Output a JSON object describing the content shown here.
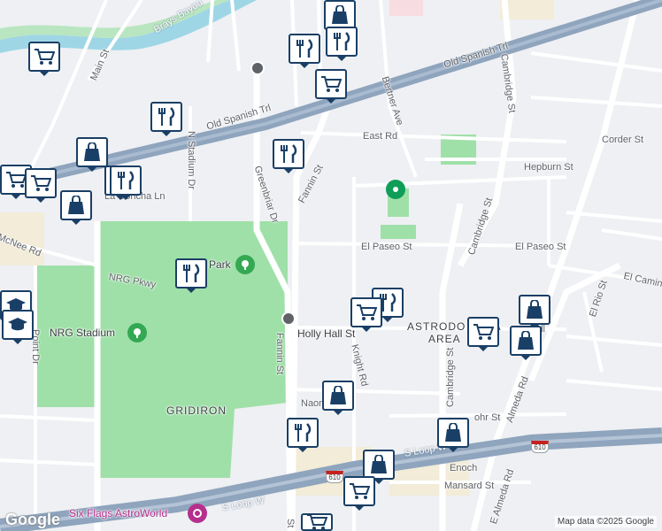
{
  "map": {
    "colors": {
      "background": "#eef0f3",
      "park": "#9fe0a8",
      "highway": "#8fa4bd",
      "water": "#9fd6e6",
      "pin_border": "#1a3f66"
    },
    "streets": {
      "brays_bayou": "Brays Bayou",
      "main_st": "Main St",
      "old_spanish_trl_top": "Old Spanish Trl",
      "old_spanish_trl_left": "Old Spanish Trl",
      "bertner_ave": "Bertner Ave",
      "cambridge_st_top": "Cambridge St",
      "cambridge_st_mid": "Cambridge St",
      "cambridge_st_low": "Cambridge St",
      "east_rd": "East Rd",
      "corder_st": "Corder St",
      "hepburn_st": "Hepburn St",
      "fannin_st_top": "Fannin St",
      "fannin_st_low": "Fannin St",
      "greenbriar_dr": "Greenbriar Dr",
      "n_stadium_dr": "N Stadium Dr",
      "la_concha_ln": "La Concha Ln",
      "mcnee_rd": "McNee Rd",
      "nrg_pkwy": "NRG Pkwy",
      "el_paseo_st_mid": "El Paseo St",
      "el_paseo_st_right": "El Paseo St",
      "el_camino": "El Camin",
      "el_rio_st": "El Rio St",
      "holly_hall_st": "Holly Hall St",
      "astrodome_area": "ASTRODO   AREA",
      "knight_rd": "Knight Rd",
      "almeda_rd": "Almeda Rd",
      "e_almeda_rd": "E Almeda Rd",
      "point_dr": "Point Dr",
      "naom": "Naom",
      "lehr_st": "ohr St",
      "gridiron": "GRIDIRON",
      "s_loop_w_right": "S Loop W",
      "s_loop_w_left": "S Loop W",
      "enoch": "Enoch",
      "mansard_st": "Mansard St",
      "fannin_bottom": "St",
      "holly_right": "oll"
    },
    "places": {
      "nrg_stadium": "NRG Stadium",
      "park": "Park",
      "six_flags": "Six Flags AstroWorld"
    },
    "shields": {
      "i610_right": "610",
      "i610_mid": "610"
    },
    "logo": "Google",
    "attribution": "Map data ©2025 Google"
  }
}
